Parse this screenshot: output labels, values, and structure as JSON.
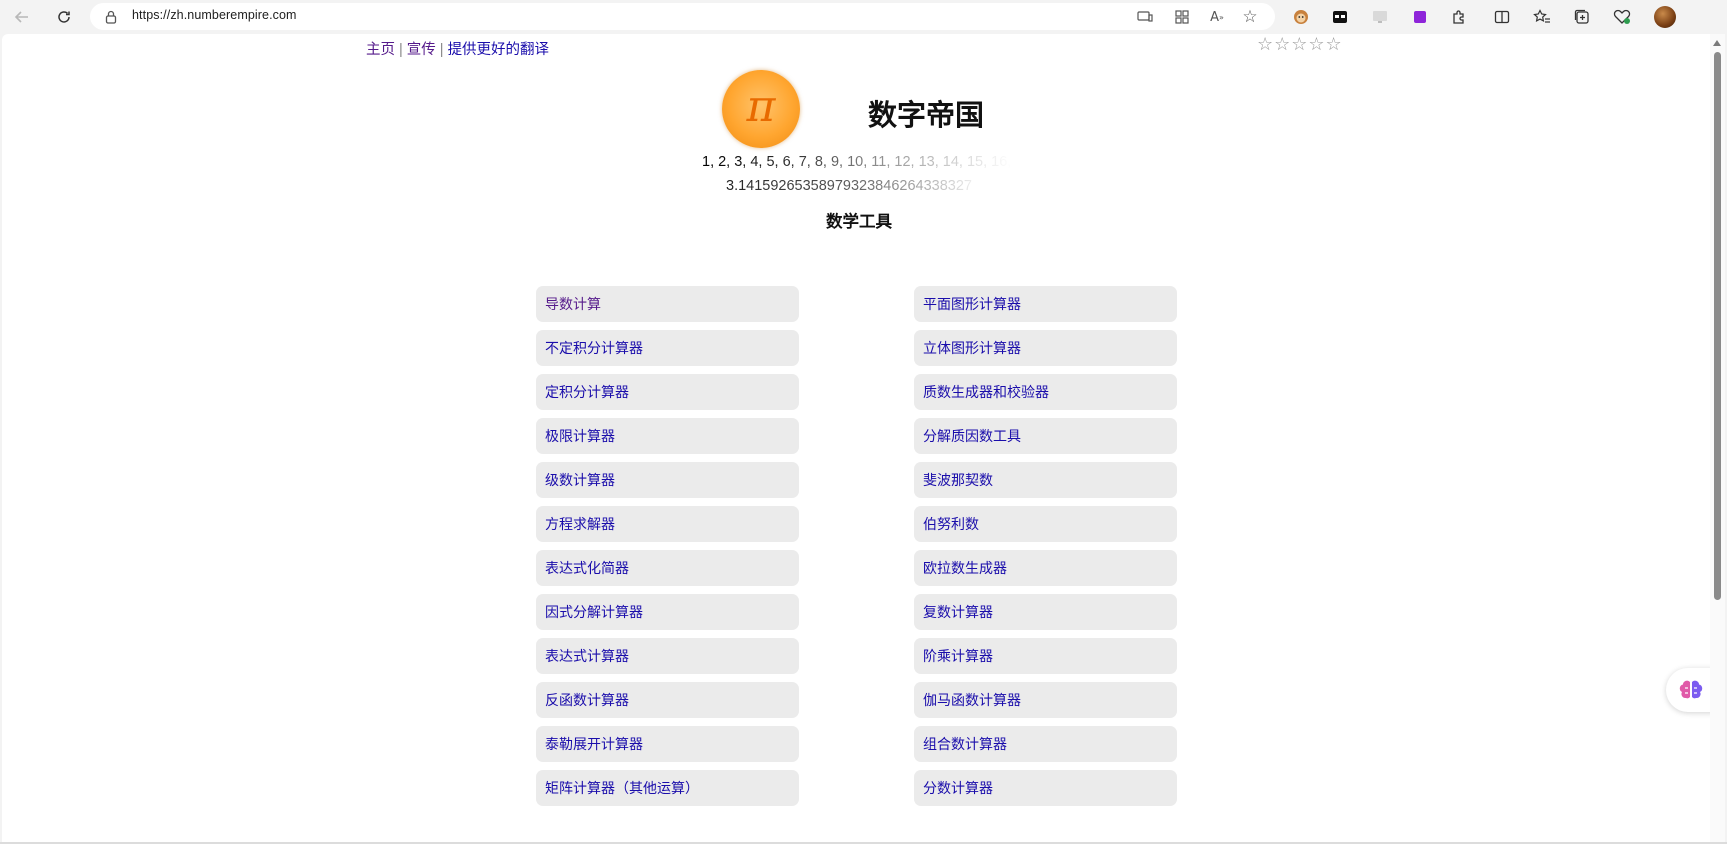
{
  "browser": {
    "url": "https://zh.numberempire.com",
    "icons": [
      "back-icon",
      "refresh-icon",
      "lock-icon",
      "device-icon",
      "apps-icon",
      "read-aloud-icon",
      "favorite-star-icon"
    ],
    "extensions": [
      "monkey-extension-icon",
      "tab-extension-icon",
      "screen-extension-icon",
      "purple-extension-icon",
      "puzzle-extensions-icon",
      "split-screen-icon",
      "favorites-icon",
      "collections-icon",
      "health-icon",
      "profile-avatar"
    ]
  },
  "header": {
    "links": [
      "主页",
      "宣传",
      "提供更好的翻译"
    ],
    "separator": "|",
    "stars": "☆☆☆☆☆"
  },
  "logo": {
    "symbol": "π"
  },
  "site_title": "数字帝国",
  "sequence": "1, 2, 3, 4, 5, 6, 7, 8, 9, 10, 11, 12, 13, 14, 15, 16,",
  "pi_digits": "3.14159265358979323846264338327",
  "section_title": "数学工具",
  "tools": {
    "left": [
      "导数计算",
      "不定积分计算器",
      "定积分计算器",
      "极限计算器",
      "级数计算器",
      "方程求解器",
      "表达式化简器",
      "因式分解计算器",
      "表达式计算器",
      "反函数计算器",
      "泰勒展开计算器",
      "矩阵计算器（其他运算）"
    ],
    "right": [
      "平面图形计算器",
      "立体图形计算器",
      "质数生成器和校验器",
      "分解质因数工具",
      "斐波那契数",
      "伯努利数",
      "欧拉数生成器",
      "复数计算器",
      "阶乘计算器",
      "伽马函数计算器",
      "组合数计算器",
      "分数计算器"
    ]
  },
  "colors": {
    "link": "#1a0dab",
    "visited": "#551a8b",
    "tile_bg": "#ebebeb",
    "logo_orange": "#ffa630"
  }
}
